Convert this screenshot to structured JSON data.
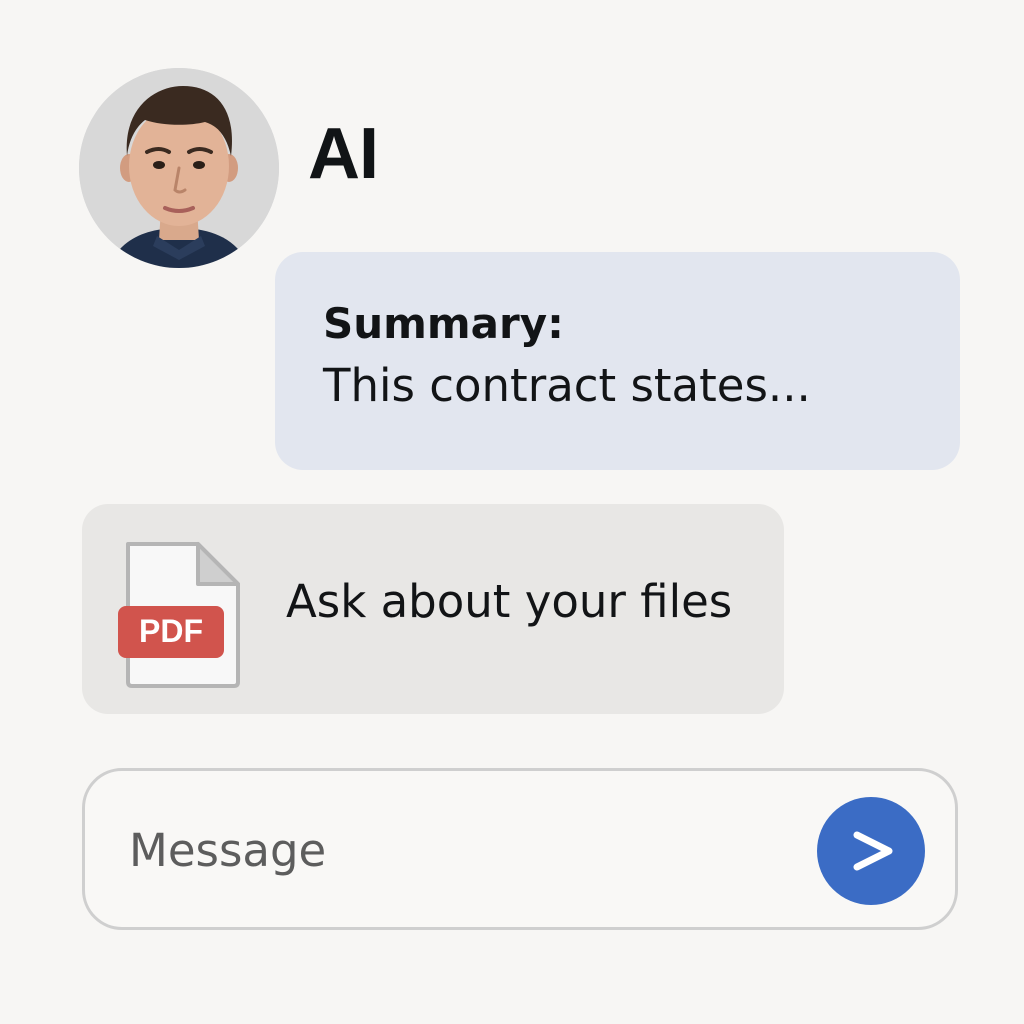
{
  "assistant": {
    "name": "AI",
    "avatar": "user-portrait"
  },
  "summary": {
    "heading": "Summary:",
    "text": "This contract states..."
  },
  "files": {
    "icon": "pdf-file-icon",
    "pdf_label": "PDF",
    "label": "Ask about your files"
  },
  "composer": {
    "placeholder": "Message",
    "value": "",
    "send_icon": "chevron-right-icon"
  },
  "colors": {
    "background": "#f7f6f4",
    "summary_bubble": "#e2e6ef",
    "files_card": "#e8e7e5",
    "send_button": "#3b6cc5",
    "pdf_badge": "#d1544d"
  }
}
